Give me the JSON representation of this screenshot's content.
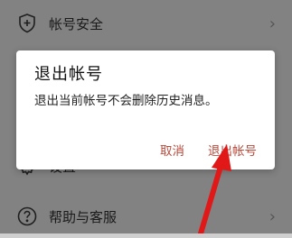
{
  "settings": {
    "items": [
      {
        "label": "帐号安全",
        "icon": "shield-plus-icon"
      },
      {
        "label": "设置",
        "icon": "gear-icon"
      },
      {
        "label": "帮助与客服",
        "icon": "question-circle-icon"
      }
    ]
  },
  "dialog": {
    "title": "退出帐号",
    "message": "退出当前帐号不会删除历史消息。",
    "cancel_label": "取消",
    "confirm_label": "退出帐号",
    "accent_color": "#b84a3c"
  },
  "annotation": {
    "arrow_color": "#e01818"
  }
}
